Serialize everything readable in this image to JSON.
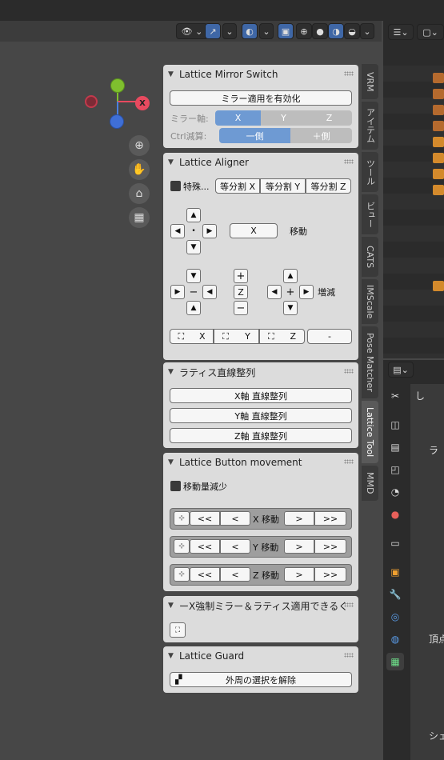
{
  "header": {
    "view_icon": "eye-icon",
    "select_icon": "cursor-icon",
    "overlay_icon": "overlay-icon",
    "xray_icon": "xray-icon",
    "shading_icons": [
      "wireframe-icon",
      "solid-icon",
      "material-icon",
      "rendered-icon"
    ]
  },
  "tabs": [
    "VRM",
    "アイテム",
    "ツール",
    "ビュー",
    "CATS",
    "IMScale",
    "Pose Matcher",
    "Lattice Tool",
    "MMD"
  ],
  "panels": {
    "mirror": {
      "title": "Lattice Mirror Switch",
      "apply_btn": "ミラー適用を有効化",
      "axis_label": "ミラー軸:",
      "axes": [
        "X",
        "Y",
        "Z"
      ],
      "ctrl_label": "Ctrl減算:",
      "sides": [
        "一側",
        "＋側"
      ]
    },
    "aligner": {
      "title": "Lattice Aligner",
      "special_label": "特殊...",
      "divide_x": "等分割 X",
      "divide_y": "等分割 Y",
      "divide_z": "等分割 Z",
      "x_btn": "X",
      "move_label": "移動",
      "z_label": "Z",
      "plus": "+",
      "minus": "−",
      "incdec_label": "増減",
      "sel_x": "X",
      "sel_y": "Y",
      "sel_z": "Z",
      "dash": "-"
    },
    "straight": {
      "title": "ラティス直線整列",
      "x_btn": "X軸 直線整列",
      "y_btn": "Y軸 直線整列",
      "z_btn": "Z軸 直線整列"
    },
    "movement": {
      "title": "Lattice Button movement",
      "reduce_label": "移動量減少",
      "rows": [
        {
          "label": "X 移動",
          "fast_back": "<<",
          "back": "<",
          "fwd": ">",
          "fast_fwd": ">>"
        },
        {
          "label": "Y 移動",
          "fast_back": "<<",
          "back": "<",
          "fwd": ">",
          "fast_fwd": ">>"
        },
        {
          "label": "Z 移動",
          "fast_back": "<<",
          "back": "<",
          "fwd": ">",
          "fast_fwd": ">>"
        }
      ]
    },
    "forcemirror": {
      "title": "ーX強制ミラー＆ラティス適用できるく"
    },
    "guard": {
      "title": "Lattice Guard",
      "deselect_btn": "外周の選択を解除"
    }
  },
  "props": {
    "label1": "し",
    "label2": "ラ",
    "label3": "頂点",
    "label4": "シェ"
  }
}
